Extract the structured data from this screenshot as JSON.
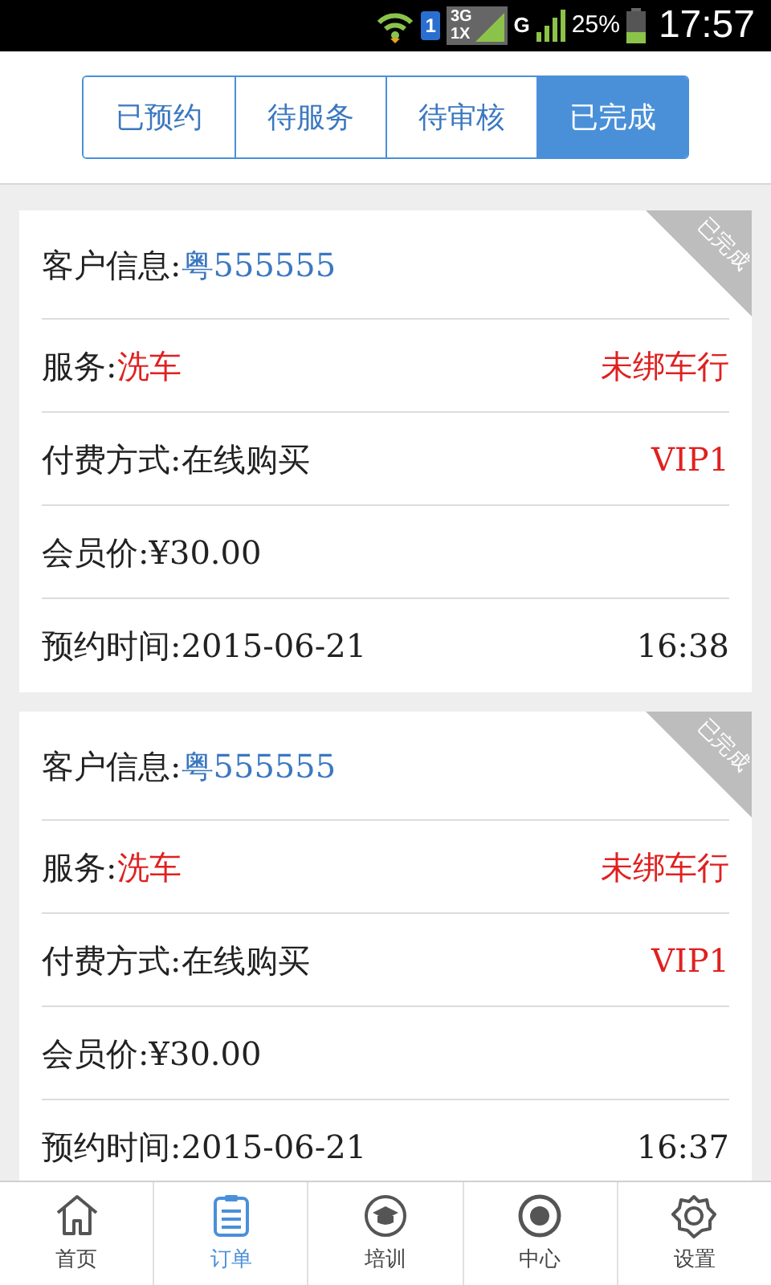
{
  "status_bar": {
    "sim": "1",
    "network": "3G",
    "network_2": "1X",
    "signal_label": "G",
    "battery": "25%",
    "time": "17:57"
  },
  "tabs": [
    {
      "label": "已预约",
      "selected": false
    },
    {
      "label": "待服务",
      "selected": false
    },
    {
      "label": "待审核",
      "selected": false
    },
    {
      "label": "已完成",
      "selected": true
    }
  ],
  "orders": [
    {
      "badge": "已完成",
      "fields": [
        {
          "kind": "plate",
          "label": "客户信息:",
          "value": "粤555555"
        },
        {
          "kind": "service",
          "label": "服务:",
          "value": "洗车",
          "right": {
            "kind": "alert",
            "text": "未绑车行"
          }
        },
        {
          "kind": "plain",
          "label": "付费方式:",
          "value": "在线购买",
          "right": {
            "kind": "alert",
            "text": "VIP1"
          }
        },
        {
          "kind": "plain",
          "label": "会员价:",
          "value": "¥30.00"
        },
        {
          "kind": "plain",
          "label": "预约时间:",
          "value": "2015-06-21",
          "right": {
            "kind": "plain",
            "text": "16:38"
          }
        }
      ]
    },
    {
      "badge": "已完成",
      "fields": [
        {
          "kind": "plate",
          "label": "客户信息:",
          "value": "粤555555"
        },
        {
          "kind": "service",
          "label": "服务:",
          "value": "洗车",
          "right": {
            "kind": "alert",
            "text": "未绑车行"
          }
        },
        {
          "kind": "plain",
          "label": "付费方式:",
          "value": "在线购买",
          "right": {
            "kind": "alert",
            "text": "VIP1"
          }
        },
        {
          "kind": "plain",
          "label": "会员价:",
          "value": "¥30.00"
        },
        {
          "kind": "plain",
          "label": "预约时间:",
          "value": "2015-06-21",
          "right": {
            "kind": "plain",
            "text": "16:37"
          }
        }
      ]
    }
  ],
  "nav": [
    {
      "label": "首页",
      "selected": false
    },
    {
      "label": "订单",
      "selected": true
    },
    {
      "label": "培训",
      "selected": false
    },
    {
      "label": "中心",
      "selected": false
    },
    {
      "label": "设置",
      "selected": false
    }
  ]
}
